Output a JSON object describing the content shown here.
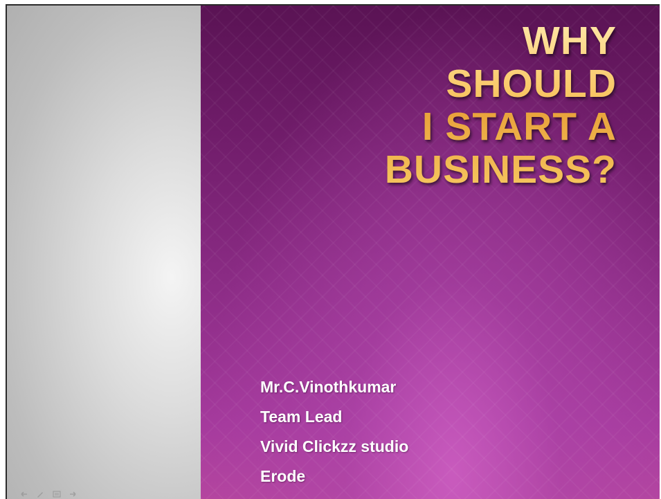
{
  "slide": {
    "title_lines": [
      "WHY",
      "SHOULD",
      "I START A",
      "BUSINESS?"
    ],
    "author_lines": [
      "Mr.C.Vinothkumar",
      "Team Lead",
      "Vivid Clickzz studio",
      "Erode"
    ]
  },
  "controls": {
    "icons": [
      "previous-arrow-icon",
      "pen-icon",
      "slide-menu-icon",
      "next-arrow-icon"
    ]
  },
  "colors": {
    "slide_background": "#8a2b84",
    "title_gold": "#f2b94a",
    "author_text": "#ffffff",
    "left_panel": "#d0d0d0"
  }
}
